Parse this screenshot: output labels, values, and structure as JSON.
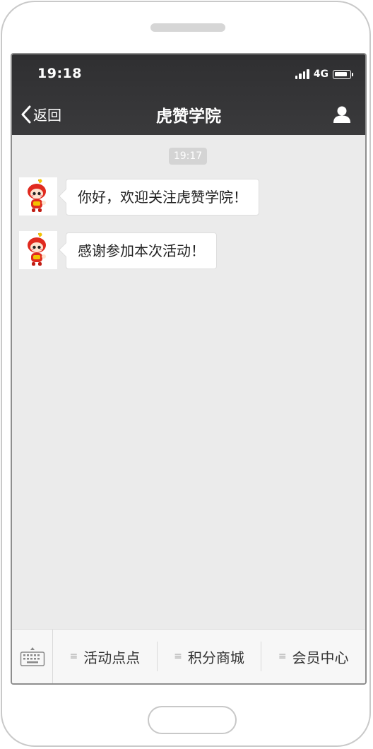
{
  "status": {
    "time": "19:18",
    "network": "4G"
  },
  "nav": {
    "back_label": "返回",
    "title": "虎赞学院",
    "profile_icon": "person-icon"
  },
  "chat": {
    "timestamp": "19:17",
    "messages": [
      {
        "text": "你好，欢迎关注虎赞学院！"
      },
      {
        "text": "感谢参加本次活动！"
      }
    ]
  },
  "menu": {
    "keyboard_icon": "keyboard-icon",
    "items": [
      {
        "label": "活动点点"
      },
      {
        "label": "积分商城"
      },
      {
        "label": "会员中心"
      }
    ]
  }
}
